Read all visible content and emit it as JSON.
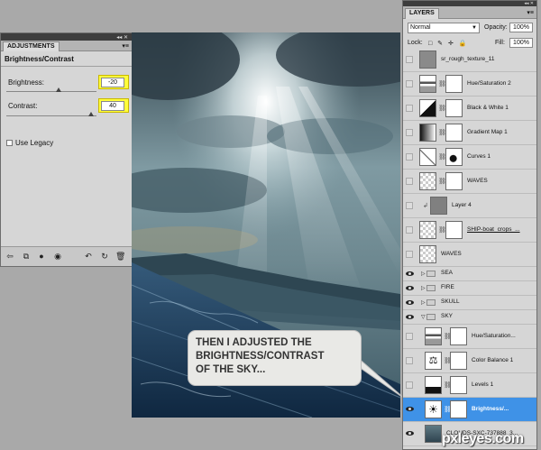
{
  "adjustments": {
    "tab_label": "ADJUSTMENTS",
    "panel_title": "Brightness/Contrast",
    "brightness": {
      "label": "Brightness:",
      "value": "-20"
    },
    "contrast": {
      "label": "Contrast:",
      "value": "40"
    },
    "legacy_label": "Use Legacy",
    "bottom_icons": [
      "back-arrow-icon",
      "clip-to-layer-icon",
      "layer-mask-icon",
      "eye-icon",
      "previous-state-icon",
      "reset-icon",
      "trash-icon"
    ]
  },
  "callout": {
    "lines": [
      "THEN I ADJUSTED THE",
      "BRIGHTNESS/CONTRAST",
      "OF THE SKY..."
    ],
    "background": "#e9e9e6"
  },
  "layers": {
    "tab_label": "LAYERS",
    "blend_mode": "Normal",
    "opacity_label": "Opacity:",
    "opacity_value": "100%",
    "lock_label": "Lock:",
    "fill_label": "Fill:",
    "fill_value": "100%",
    "items": [
      {
        "name": "sr_rough_texture_11",
        "kind": "image",
        "visible": false
      },
      {
        "name": "Hue/Saturation 2",
        "kind": "adjustment",
        "visible": false
      },
      {
        "name": "Black & White 1",
        "kind": "adjustment",
        "visible": false
      },
      {
        "name": "Gradient Map 1",
        "kind": "adjustment",
        "visible": false
      },
      {
        "name": "Curves 1",
        "kind": "adjustment",
        "visible": false
      },
      {
        "name": "WAVES",
        "kind": "masked",
        "visible": false
      },
      {
        "name": "Layer 4",
        "kind": "image",
        "visible": false
      },
      {
        "name": "SHIP-boat_crops_...",
        "kind": "masked",
        "visible": false
      },
      {
        "name": "WAVES",
        "kind": "plain",
        "visible": false
      },
      {
        "name": "SEA",
        "kind": "group",
        "visible": true
      },
      {
        "name": "FIRE",
        "kind": "group",
        "visible": true
      },
      {
        "name": "SKULL",
        "kind": "group",
        "visible": true
      },
      {
        "name": "SKY",
        "kind": "group-open",
        "visible": true
      },
      {
        "name": "Hue/Saturation...",
        "kind": "adjustment",
        "visible": false
      },
      {
        "name": "Color Balance 1",
        "kind": "adjustment",
        "visible": false
      },
      {
        "name": "Levels 1",
        "kind": "adjustment",
        "visible": false
      },
      {
        "name": "Brightness/...",
        "kind": "adjustment",
        "visible": true,
        "selected": true
      },
      {
        "name": "CLOUDS-SXC-737888_3...",
        "kind": "image",
        "visible": true
      }
    ],
    "selected_color": "#3f92e7"
  },
  "watermark": "pxleyes.com"
}
